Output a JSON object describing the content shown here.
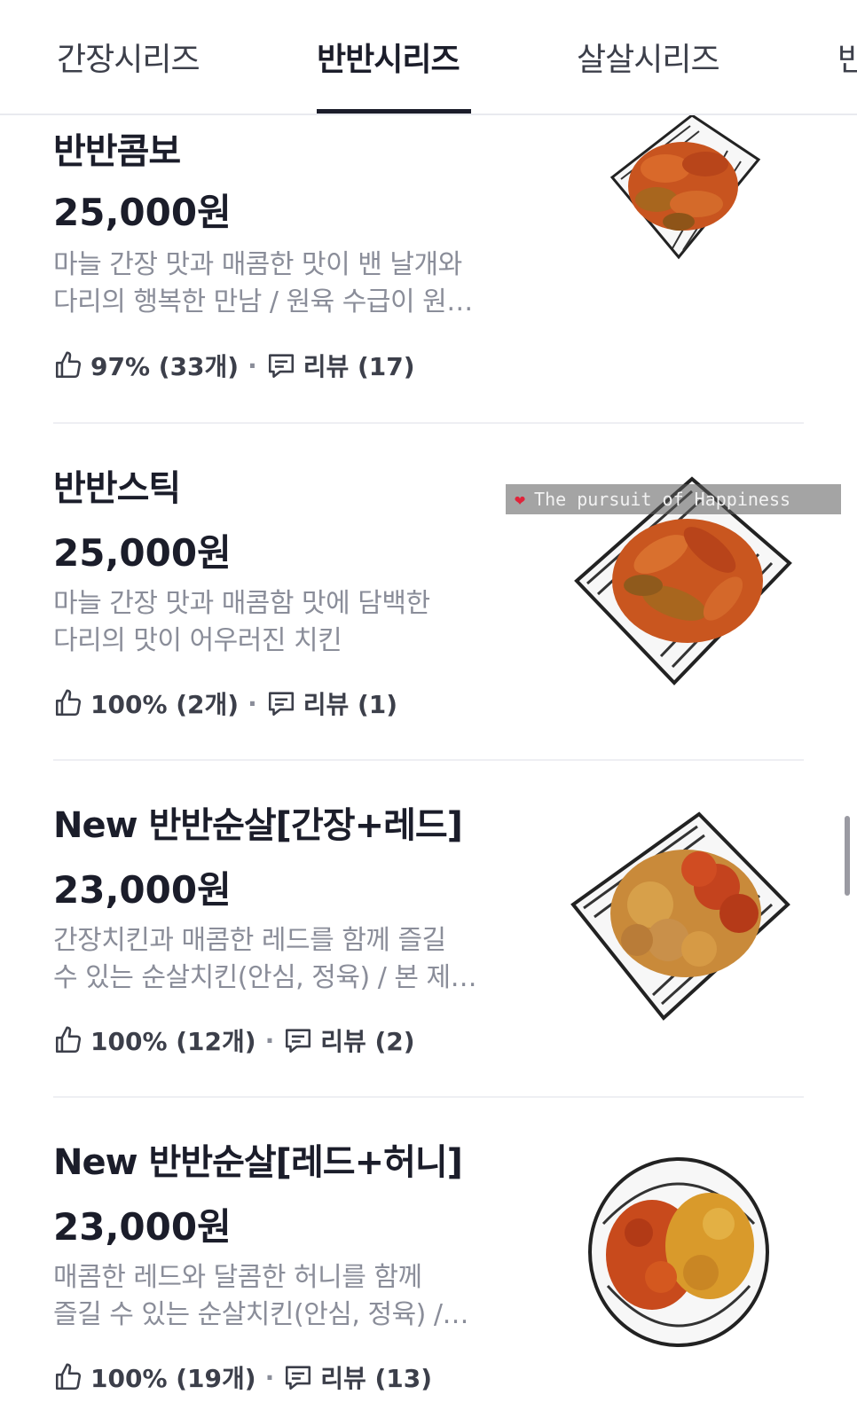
{
  "tabs": [
    {
      "label": "간장시리즈",
      "active": false
    },
    {
      "label": "반반시리즈",
      "active": true
    },
    {
      "label": "살살시리즈",
      "active": false
    },
    {
      "label": "반",
      "active": false
    }
  ],
  "items": [
    {
      "name": "반반콤보",
      "price": "25,000원",
      "desc_line1": "마늘 간장 맛과 매콤한 맛이 밴 날개와",
      "desc_line2": "다리의 행복한 만남 / 원육 수급이 원…",
      "like": "97% (33개)",
      "review": "리뷰 (17)"
    },
    {
      "name": "반반스틱",
      "price": "25,000원",
      "desc_line1": "마늘 간장 맛과 매콤함 맛에 담백한",
      "desc_line2": "다리의 맛이 어우러진 치킨",
      "like": "100% (2개)",
      "review": "리뷰 (1)"
    },
    {
      "name": "New 반반순살[간장+레드]",
      "price": "23,000원",
      "desc_line1": "간장치킨과 매콤한 레드를 함께 즐길",
      "desc_line2": "수 있는 순살치킨(안심, 정육) / 본 제…",
      "like": "100% (12개)",
      "review": "리뷰 (2)"
    },
    {
      "name": "New 반반순살[레드+허니]",
      "price": "23,000원",
      "desc_line1": "매콤한 레드와 달콤한 허니를 함께",
      "desc_line2": "즐길 수 있는 순살치킨(안심, 정육) /…",
      "like": "100% (19개)",
      "review": "리뷰 (13)"
    }
  ],
  "watermark": {
    "text": "The pursuit of Happiness"
  },
  "colors": {
    "text": "#1b1d2a",
    "muted": "#8a8d99",
    "chicken_red": "#c8431c",
    "chicken_soy": "#b5692e",
    "chicken_honey": "#d99a2b"
  }
}
